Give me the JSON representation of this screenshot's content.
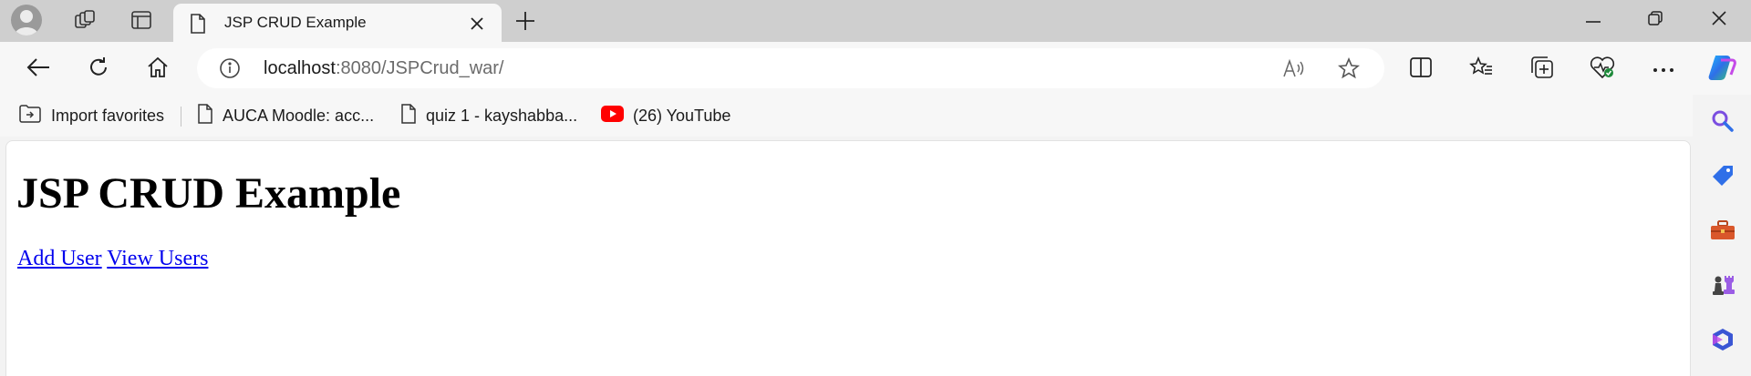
{
  "tab": {
    "title": "JSP CRUD Example"
  },
  "address_bar": {
    "host": "localhost",
    "path": ":8080/JSPCrud_war/"
  },
  "favorites": [
    {
      "label": "Import favorites"
    },
    {
      "label": "AUCA Moodle: acc..."
    },
    {
      "label": "quiz 1 - kayshabba..."
    },
    {
      "label": "(26) YouTube"
    }
  ],
  "page": {
    "heading": "JSP CRUD Example",
    "links": [
      {
        "label": "Add User"
      },
      {
        "label": "View Users"
      }
    ]
  },
  "icons": {
    "tabstrip": [
      "profile-avatar",
      "workspaces-icon",
      "tab-actions-icon",
      "page-icon",
      "close-icon",
      "plus-icon"
    ],
    "window": [
      "minimize-icon",
      "restore-icon",
      "close-icon"
    ],
    "toolbar": [
      "back-arrow-icon",
      "refresh-icon",
      "home-icon",
      "info-icon",
      "read-aloud-icon",
      "star-icon",
      "split-screen-icon",
      "favorites-icon",
      "collections-icon",
      "browser-essentials-icon",
      "more-icon",
      "copilot-icon"
    ],
    "sidebar": [
      "search-icon",
      "tag-icon",
      "toolbox-icon",
      "chess-icon",
      "microsoft-365-icon"
    ]
  },
  "colors": {
    "link": "#0000ee",
    "youtube": "#ff0000",
    "tabstrip_bg": "#cfcfcf",
    "toolbar_bg": "#f7f7f7"
  }
}
